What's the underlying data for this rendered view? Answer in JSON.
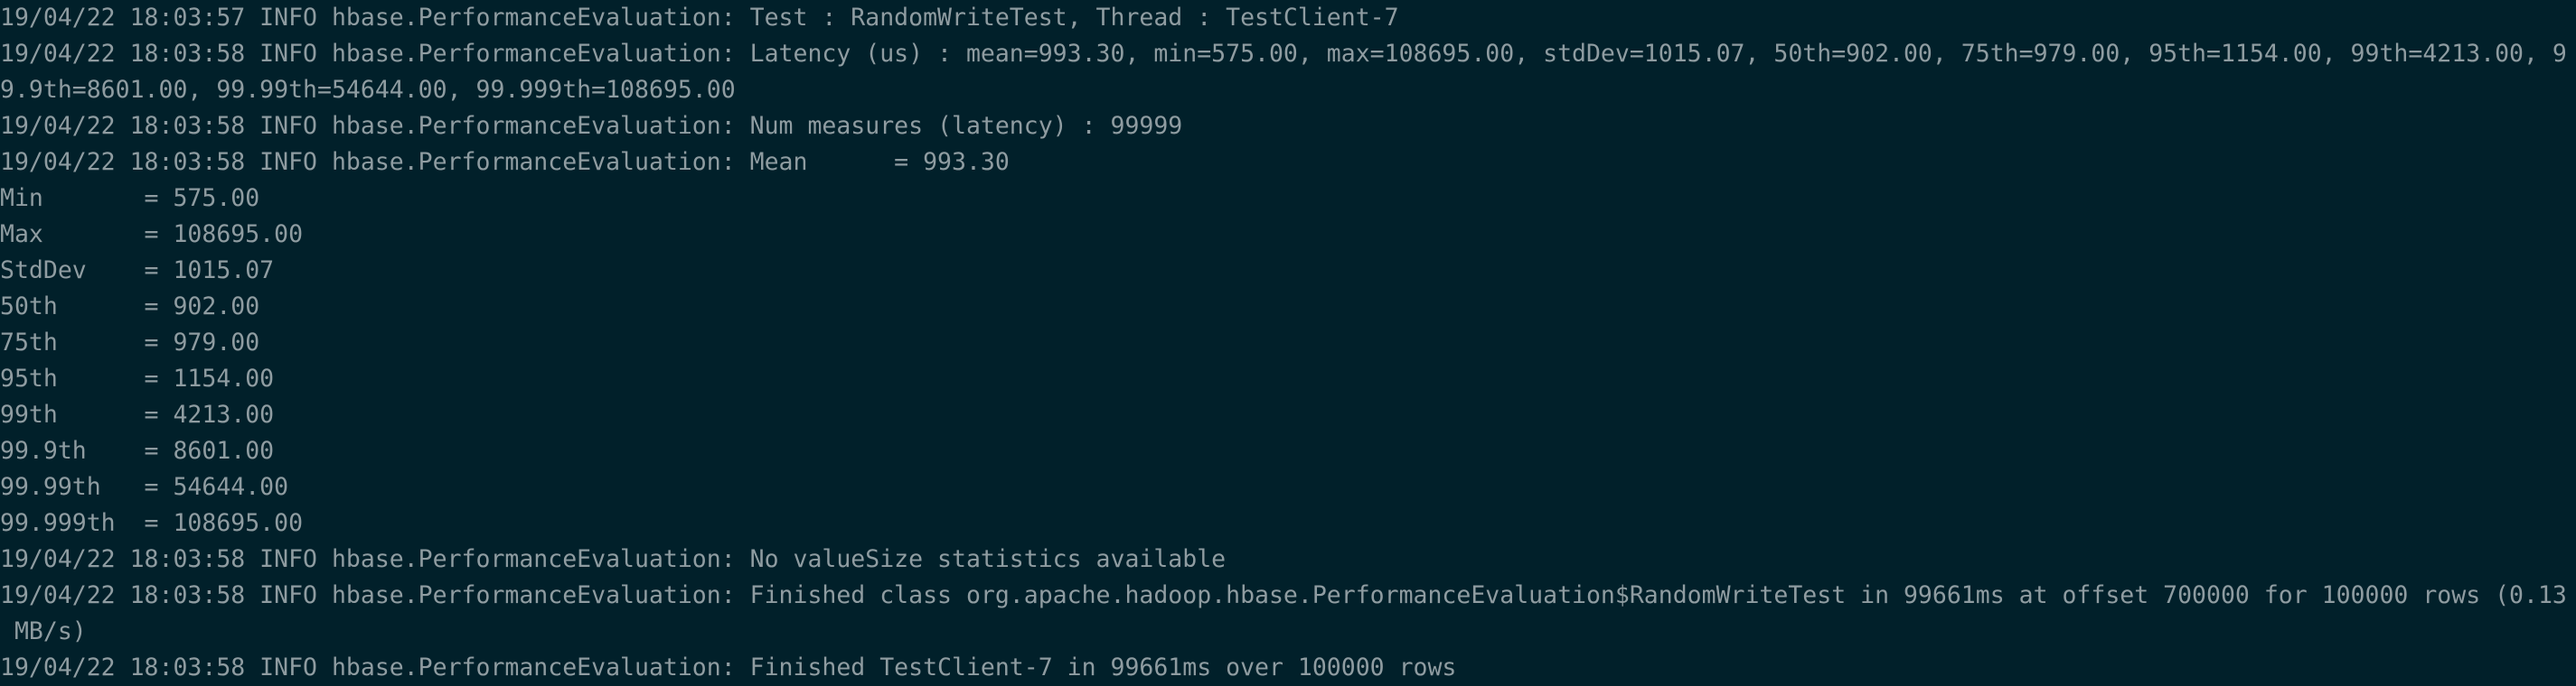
{
  "terminal": {
    "lines": [
      "19/04/22 18:03:57 INFO hbase.PerformanceEvaluation: Test : RandomWriteTest, Thread : TestClient-7",
      "19/04/22 18:03:58 INFO hbase.PerformanceEvaluation: Latency (us) : mean=993.30, min=575.00, max=108695.00, stdDev=1015.07, 50th=902.00, 75th=979.00, 95th=1154.00, 99th=4213.00, 9",
      "9.9th=8601.00, 99.99th=54644.00, 99.999th=108695.00",
      "19/04/22 18:03:58 INFO hbase.PerformanceEvaluation: Num measures (latency) : 99999",
      "19/04/22 18:03:58 INFO hbase.PerformanceEvaluation: Mean      = 993.30",
      "Min       = 575.00",
      "Max       = 108695.00",
      "StdDev    = 1015.07",
      "50th      = 902.00",
      "75th      = 979.00",
      "95th      = 1154.00",
      "99th      = 4213.00",
      "99.9th    = 8601.00",
      "99.99th   = 54644.00",
      "99.999th  = 108695.00",
      "19/04/22 18:03:58 INFO hbase.PerformanceEvaluation: No valueSize statistics available",
      "19/04/22 18:03:58 INFO hbase.PerformanceEvaluation: Finished class org.apache.hadoop.hbase.PerformanceEvaluation$RandomWriteTest in 99661ms at offset 700000 for 100000 rows (0.13",
      " MB/s)",
      "19/04/22 18:03:58 INFO hbase.PerformanceEvaluation: Finished TestClient-7 in 99661ms over 100000 rows"
    ]
  }
}
